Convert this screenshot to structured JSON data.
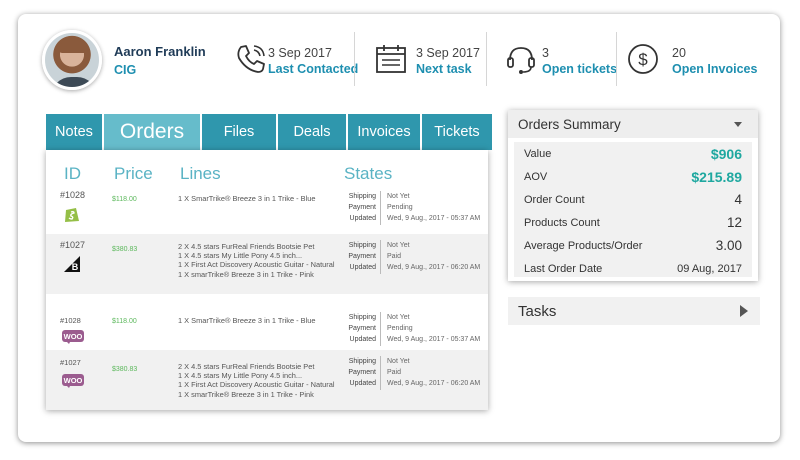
{
  "contact": {
    "name": "Aaron Franklin",
    "company": "CIG"
  },
  "stats": [
    {
      "icon": "phone-icon",
      "value": "3 Sep 2017",
      "label": "Last Contacted"
    },
    {
      "icon": "calendar-icon",
      "value": "3 Sep 2017",
      "label": "Next task"
    },
    {
      "icon": "headset-icon",
      "value": "3",
      "label": "Open tickets"
    },
    {
      "icon": "dollar-icon",
      "value": "20",
      "label": "Open Invoices"
    }
  ],
  "tabs": [
    "Notes",
    "Orders",
    "Files",
    "Deals",
    "Invoices",
    "Tickets"
  ],
  "active_tab": "Orders",
  "orders": {
    "headers": {
      "id": "ID",
      "price": "Price",
      "lines": "Lines",
      "states": "States"
    },
    "state_labels": [
      "Shipping",
      "Payment",
      "Updated"
    ],
    "rows": [
      {
        "id": "#1028",
        "platform": "shopify-logo",
        "price": "$118.00",
        "lines": [
          "1 X SmarTrike® Breeze 3 in 1 Trike - Blue"
        ],
        "states": [
          "Not Yet",
          "Pending",
          "Wed, 9 Aug., 2017 - 05:37 AM"
        ]
      },
      {
        "id": "#1027",
        "platform": "bigcommerce-logo",
        "price": "$380.83",
        "lines": [
          "2 X 4.5 stars FurReal Friends Bootsie Pet",
          "1 X 4.5 stars My Little Pony 4.5 inch...",
          "1 X First Act Discovery Acoustic Guitar - Natural",
          "1 X smarTrike® Breeze 3 in 1 Trike - Pink"
        ],
        "states": [
          "Not Yet",
          "Paid",
          "Wed, 9 Aug., 2017 - 06:20 AM"
        ]
      },
      {
        "id": "#1028",
        "platform": "woo-logo",
        "price": "$118.00",
        "lines": [
          "1 X SmarTrike® Breeze 3 in 1 Trike - Blue"
        ],
        "states": [
          "Not Yet",
          "Pending",
          "Wed, 9 Aug., 2017 - 05:37 AM"
        ]
      },
      {
        "id": "#1027",
        "platform": "woo-logo",
        "price": "$380.83",
        "lines": [
          "2 X 4.5 stars FurReal Friends Bootsie Pet",
          "1 X 4.5 stars My Little Pony 4.5 inch...",
          "1 X First Act Discovery Acoustic Guitar - Natural",
          "1 X smarTrike® Breeze 3 in 1 Trike - Pink"
        ],
        "states": [
          "Not Yet",
          "Paid",
          "Wed, 9 Aug., 2017 - 06:20 AM"
        ]
      }
    ]
  },
  "logos": {
    "woo": "WOO"
  },
  "summary": {
    "title": "Orders Summary",
    "rows": [
      {
        "label": "Value",
        "value": "$906"
      },
      {
        "label": "AOV",
        "value": "$215.89"
      },
      {
        "label": "Order Count",
        "value": "4"
      },
      {
        "label": "Products Count",
        "value": "12"
      },
      {
        "label": "Average Products/Order",
        "value": "3.00"
      },
      {
        "label": "Last Order Date",
        "value": "09 Aug, 2017"
      }
    ]
  },
  "tasks": {
    "title": "Tasks"
  },
  "colors": {
    "tab": "#2f97ad",
    "tab_active": "#66bccb",
    "link": "#1e8fb0",
    "money": "#1fa8a0",
    "price": "#5cb85c"
  }
}
